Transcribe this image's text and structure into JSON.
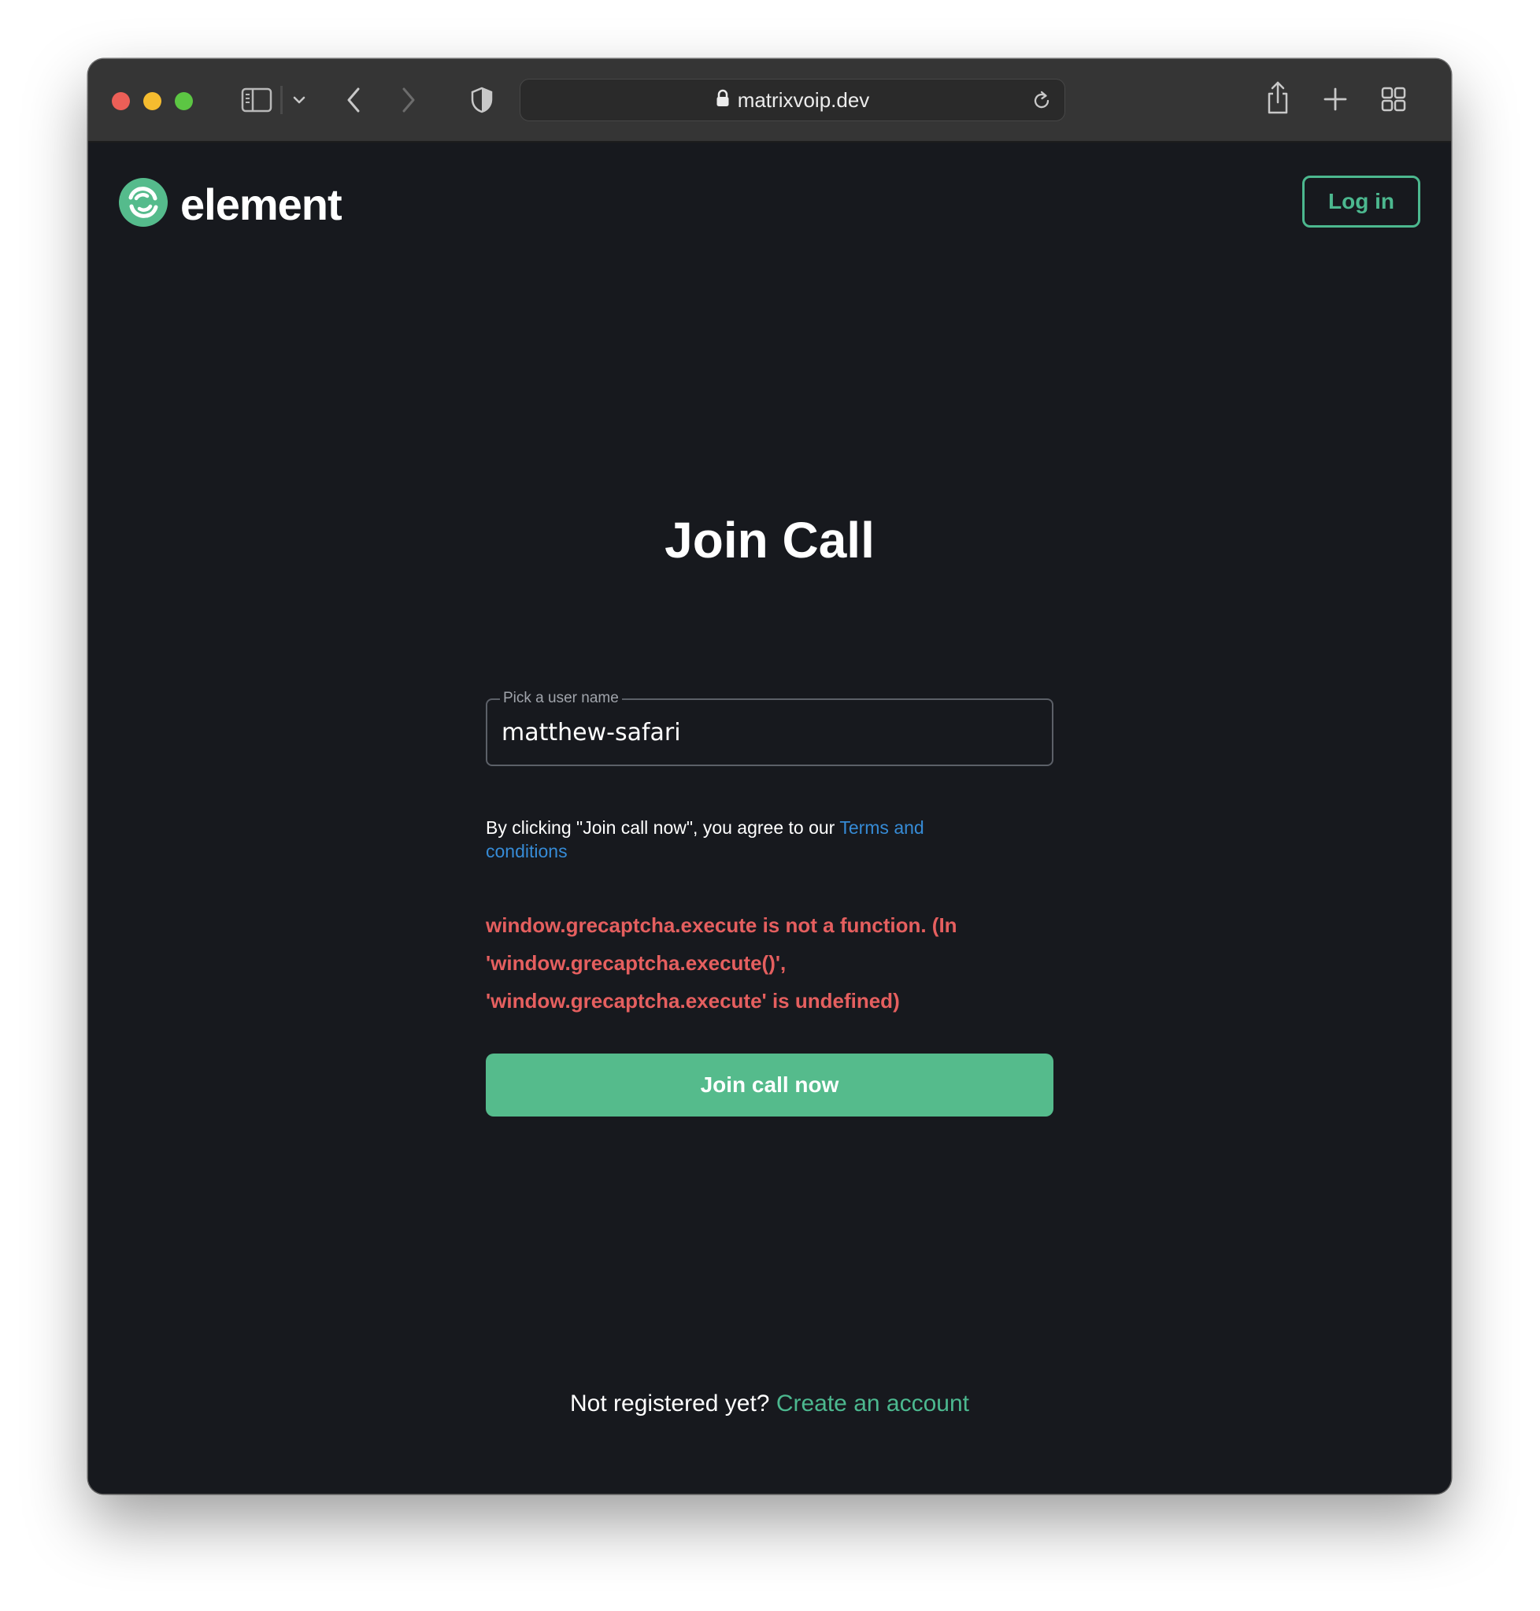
{
  "browser": {
    "url": "matrixvoip.dev",
    "icons": {
      "close": "traffic-light-close",
      "minimize": "traffic-light-minimize",
      "zoom": "traffic-light-zoom",
      "sidebar": "sidebar-icon",
      "tab_group_menu": "chevron-down-icon",
      "back": "back-icon",
      "forward": "forward-icon",
      "privacy": "shield-icon",
      "lock": "lock-icon",
      "reload": "reload-icon",
      "share": "share-icon",
      "new_tab": "plus-icon",
      "tab_overview": "tab-overview-icon"
    }
  },
  "header": {
    "brand_name": "element",
    "login_label": "Log in"
  },
  "main": {
    "title": "Join Call",
    "username_label": "Pick a user name",
    "username_value": "matthew-safari",
    "terms_prefix": "By clicking \"Join call now\", you agree to our ",
    "terms_link": "Terms and conditions",
    "error_lines": [
      "window.grecaptcha.execute is not a function. (In",
      "'window.grecaptcha.execute()',",
      "'window.grecaptcha.execute' is undefined)"
    ],
    "join_label": "Join call now"
  },
  "footer": {
    "prompt": "Not registered yet? ",
    "link": "Create an account"
  },
  "colors": {
    "background": "#17191e",
    "accent": "#55bb8c",
    "link": "#368bd6",
    "error": "#e55f5f"
  }
}
